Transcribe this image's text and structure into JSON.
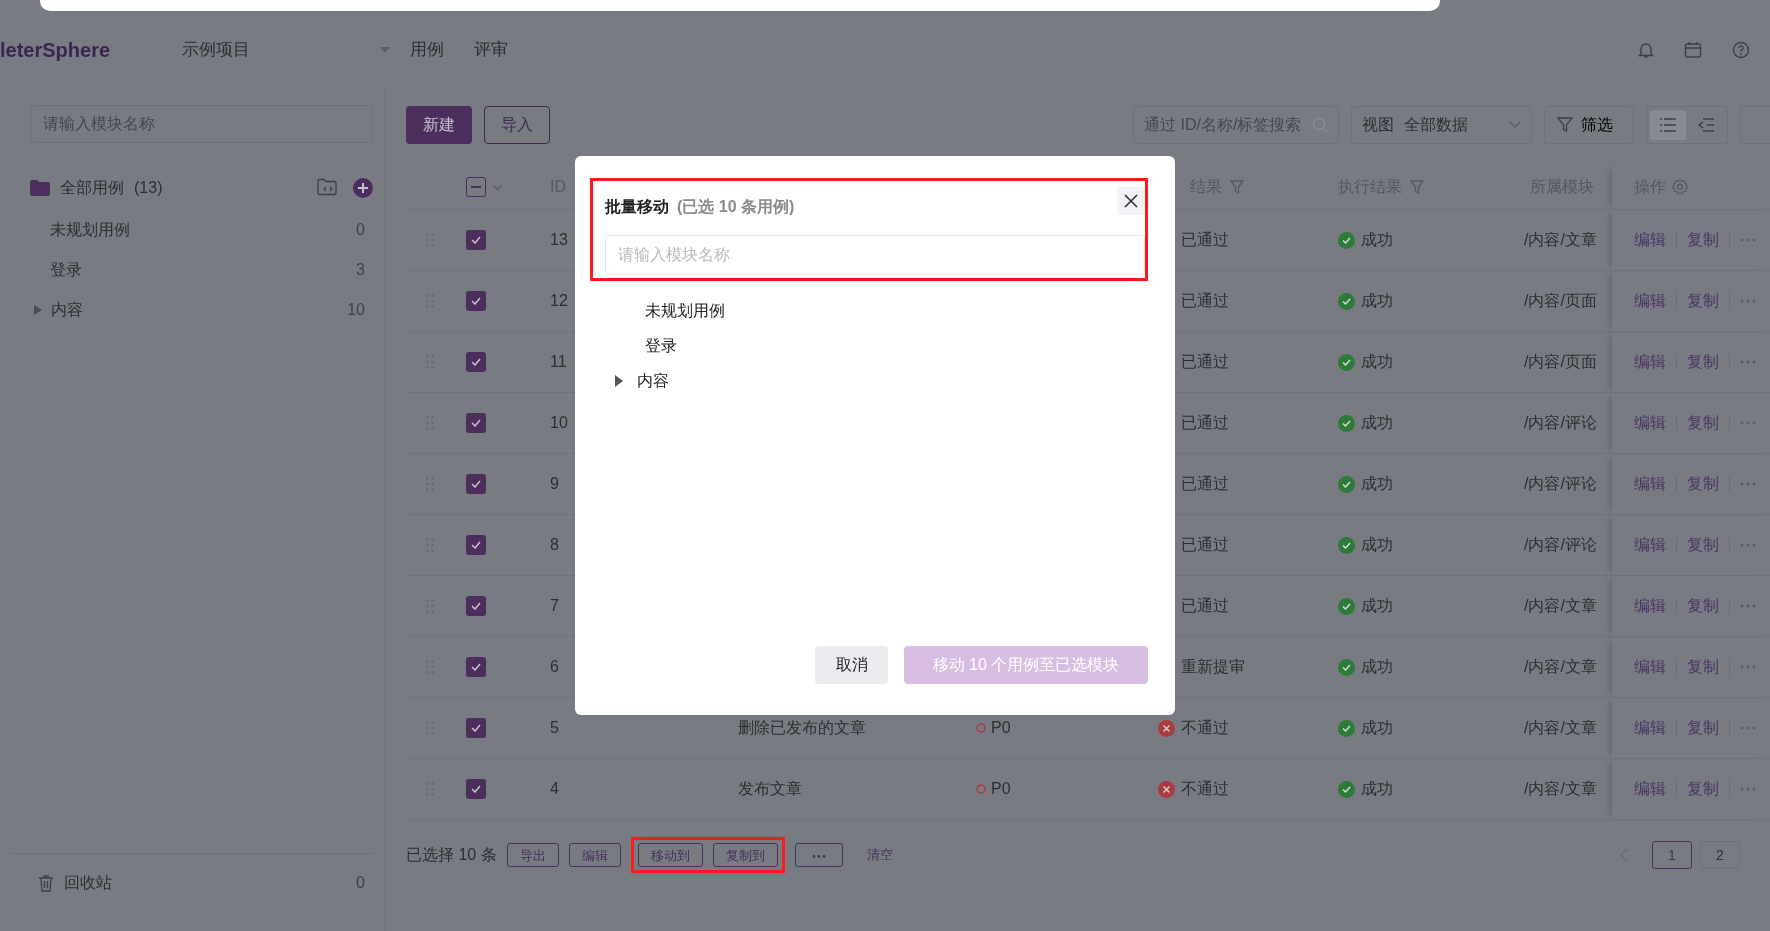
{
  "header": {
    "logo": "leterSphere",
    "project": "示例项目",
    "tabs": [
      "用例",
      "评审"
    ]
  },
  "sidebar": {
    "search": {
      "placeholder": "请输入模块名称"
    },
    "root": {
      "label": "全部用例",
      "count": "(13)"
    },
    "modules": [
      {
        "label": "未规划用例",
        "count": "0",
        "kind": "leaf"
      },
      {
        "label": "登录",
        "count": "3",
        "kind": "leaf"
      },
      {
        "label": "内容",
        "count": "10",
        "kind": "group"
      }
    ],
    "recycle": {
      "label": "回收站",
      "count": "0"
    }
  },
  "toolbar": {
    "buttons": [
      {
        "label": "新建",
        "kind": "primary"
      },
      {
        "label": "导入",
        "kind": "outline"
      }
    ],
    "search": {
      "placeholder": "通过 ID/名称/标签搜索"
    },
    "view": {
      "label": "视图",
      "value": "全部数据"
    },
    "filter": "筛选"
  },
  "table": {
    "select_all": {
      "partial": true
    },
    "header": {
      "id": "ID",
      "review": "结果",
      "exec": "执行结果",
      "module": "所属模块",
      "ops": "操作"
    },
    "rows": [
      {
        "id": "13",
        "checked": true,
        "review": "已通过",
        "exec": "成功",
        "exec_ok": true,
        "module": "/内容/文章",
        "actions": [
          "编辑",
          "复制"
        ]
      },
      {
        "id": "12",
        "checked": true,
        "review": "已通过",
        "exec": "成功",
        "exec_ok": true,
        "module": "/内容/页面",
        "actions": [
          "编辑",
          "复制"
        ]
      },
      {
        "id": "11",
        "checked": true,
        "review": "已通过",
        "exec": "成功",
        "exec_ok": true,
        "module": "/内容/页面",
        "actions": [
          "编辑",
          "复制"
        ]
      },
      {
        "id": "10",
        "checked": true,
        "review": "已通过",
        "exec": "成功",
        "exec_ok": true,
        "module": "/内容/评论",
        "actions": [
          "编辑",
          "复制"
        ]
      },
      {
        "id": "9",
        "checked": true,
        "review": "已通过",
        "exec": "成功",
        "exec_ok": true,
        "module": "/内容/评论",
        "actions": [
          "编辑",
          "复制"
        ]
      },
      {
        "id": "8",
        "checked": true,
        "review": "已通过",
        "exec": "成功",
        "exec_ok": true,
        "module": "/内容/评论",
        "actions": [
          "编辑",
          "复制"
        ]
      },
      {
        "id": "7",
        "checked": true,
        "review": "已通过",
        "exec": "成功",
        "exec_ok": true,
        "module": "/内容/文章",
        "actions": [
          "编辑",
          "复制"
        ]
      },
      {
        "id": "6",
        "checked": true,
        "review": "重新提审",
        "exec": "成功",
        "exec_ok": true,
        "module": "/内容/文章",
        "actions": [
          "编辑",
          "复制"
        ]
      },
      {
        "id": "5",
        "checked": true,
        "name": "删除已发布的文章",
        "level": "P0",
        "review": "不通过",
        "review_ok": false,
        "exec": "成功",
        "exec_ok": true,
        "module": "/内容/文章",
        "actions": [
          "编辑",
          "复制"
        ]
      },
      {
        "id": "4",
        "checked": true,
        "name": "发布文章",
        "level": "P0",
        "review": "不通过",
        "review_ok": false,
        "exec": "成功",
        "exec_ok": true,
        "module": "/内容/文章",
        "actions": [
          "编辑",
          "复制"
        ]
      }
    ]
  },
  "batch_bar": {
    "selected_text": "已选择 10 条",
    "actions": [
      {
        "label": "导出",
        "highlighted": false
      },
      {
        "label": "编辑",
        "highlighted": false
      },
      {
        "label": "移动到",
        "highlighted": true
      },
      {
        "label": "复制到",
        "highlighted": true
      }
    ],
    "clear": "清空",
    "pages": [
      {
        "label": "1",
        "selected": true
      },
      {
        "label": "2",
        "selected": false
      }
    ]
  },
  "modal": {
    "title": "批量移动",
    "subtitle": "(已选 10 条用例)",
    "highlighted": true,
    "search": {
      "placeholder": "请输入模块名称"
    },
    "modules": [
      {
        "label": "未规划用例",
        "kind": "leaf"
      },
      {
        "label": "登录",
        "kind": "leaf"
      },
      {
        "label": "内容",
        "kind": "group"
      }
    ],
    "buttons": [
      {
        "label": "取消",
        "kind": "secondary",
        "disabled": false
      },
      {
        "label": "移动 10 个用例至已选模块",
        "kind": "primary",
        "disabled": true
      }
    ]
  }
}
